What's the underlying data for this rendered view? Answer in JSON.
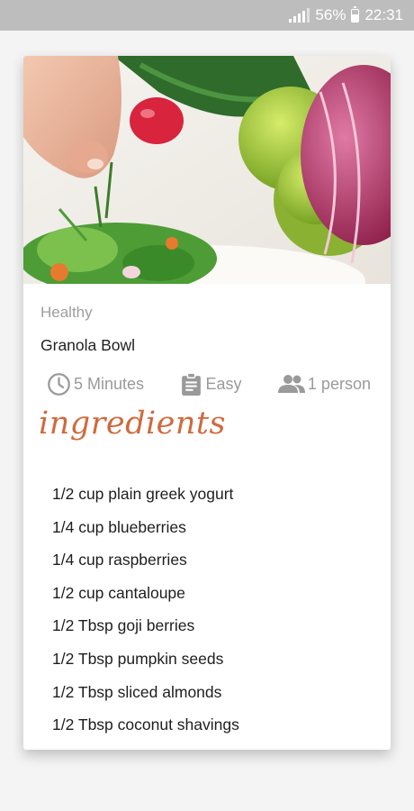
{
  "status_bar": {
    "battery_percent": "56%",
    "battery_level": 0.56,
    "time": "22:31"
  },
  "recipe": {
    "category": "Healthy",
    "title": "Granola Bowl",
    "meta": {
      "time": "5 Minutes",
      "difficulty": "Easy",
      "servings": "1 person"
    },
    "ingredients_heading": "ingredients",
    "ingredients": [
      "1/2 cup plain greek yogurt",
      "1/4 cup blueberries",
      "1/4 cup raspberries",
      "1/2 cup cantaloupe",
      "1/2 Tbsp goji berries",
      "1/2 Tbsp pumpkin seeds",
      "1/2 Tbsp sliced almonds",
      "1/2 Tbsp coconut shavings"
    ]
  },
  "icons": {
    "time": "clock-icon",
    "difficulty": "clipboard-icon",
    "servings": "people-icon"
  },
  "colors": {
    "status_bar": "#bdbdbd",
    "heading_accent": "#d06a3d",
    "meta_gray": "#9a9a9a"
  }
}
